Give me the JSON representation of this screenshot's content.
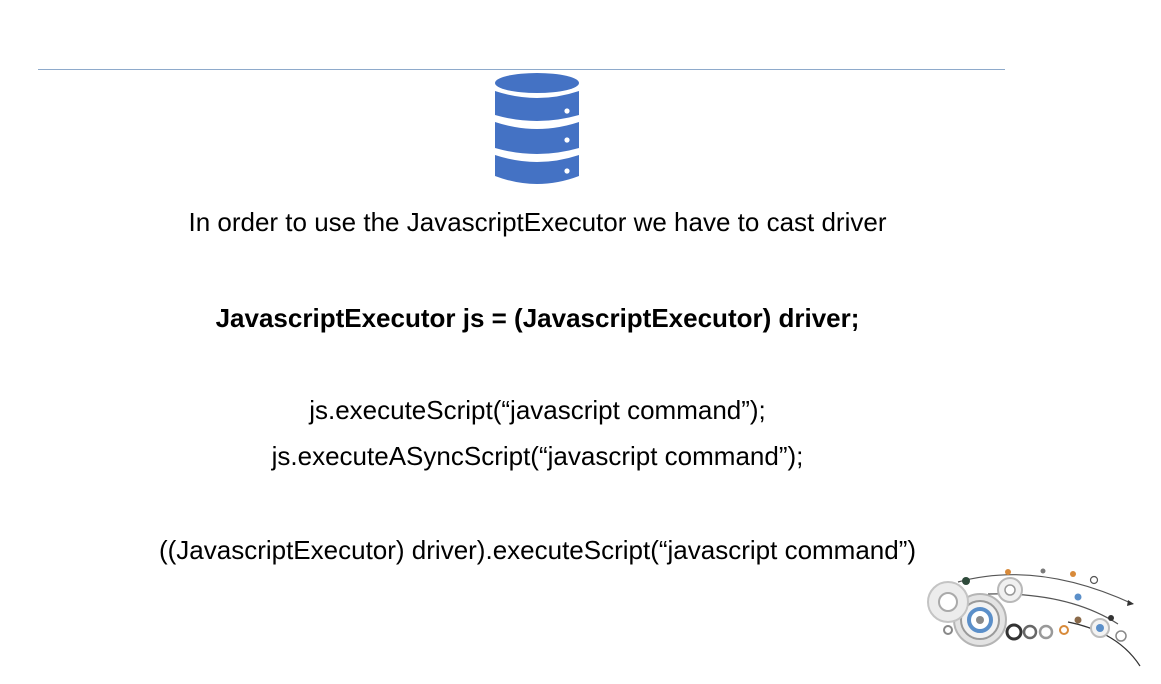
{
  "slide": {
    "intro_text": "In order to use the JavascriptExecutor we have to cast driver",
    "cast_statement": "JavascriptExecutor js = (JavascriptExecutor) driver;",
    "execute_script_example": "js.executeScript(“javascript command”);",
    "execute_async_script_example": "js.executeASyncScript(“javascript command”);",
    "inline_cast_example": "((JavascriptExecutor) driver).executeScript(“javascript command”)"
  },
  "icons": {
    "database": "database-icon",
    "decoration": "gears-decoration-icon"
  },
  "colors": {
    "database_blue": "#4472c4",
    "rule_line": "#8eaacb",
    "text": "#000000",
    "background": "#ffffff"
  }
}
